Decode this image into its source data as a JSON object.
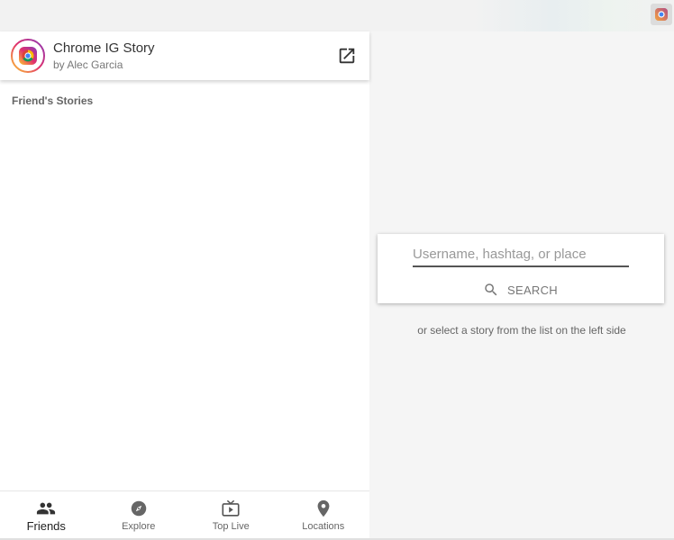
{
  "app": {
    "title": "Chrome IG Story",
    "author": "by Alec Garcia"
  },
  "colors": {
    "accent": "#333333",
    "panel_bg": "#ffffff",
    "content_bg": "#f5f5f5"
  },
  "friends_section": {
    "title": "Friend's Stories"
  },
  "search": {
    "placeholder": "Username, hashtag, or place",
    "value": "",
    "button_label": "SEARCH",
    "hint": "or select a story from the list on the left side"
  },
  "bottom_nav": {
    "tabs": [
      {
        "label": "Friends",
        "icon": "people-icon",
        "active": true
      },
      {
        "label": "Explore",
        "icon": "compass-icon",
        "active": false
      },
      {
        "label": "Top Live",
        "icon": "live-tv-icon",
        "active": false
      },
      {
        "label": "Locations",
        "icon": "location-pin-icon",
        "active": false
      }
    ]
  }
}
